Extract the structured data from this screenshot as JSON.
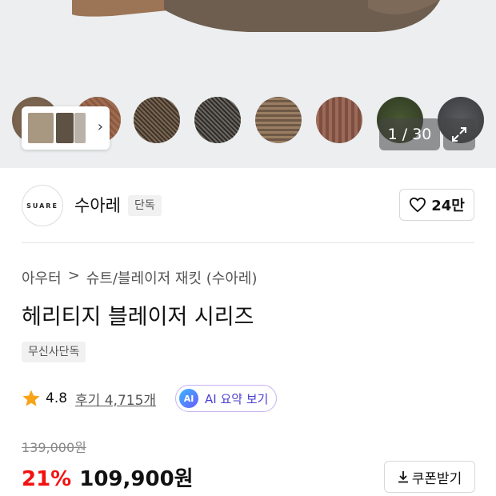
{
  "gallery": {
    "counter": "1 / 30",
    "swatches": [
      {
        "name": "brown-tweed",
        "color": "#7a6450"
      },
      {
        "name": "rust-check",
        "color": "#9b6a4e"
      },
      {
        "name": "houndstooth-brown",
        "color": "#6b5a48"
      },
      {
        "name": "houndstooth-black",
        "color": "#5a5550"
      },
      {
        "name": "glen-check",
        "color": "#8c7258"
      },
      {
        "name": "brown-plaid",
        "color": "#8e5f4f"
      },
      {
        "name": "green-tweed",
        "color": "#3d4a2c"
      },
      {
        "name": "charcoal-tweed",
        "color": "#4a4b4d"
      }
    ],
    "thumbs": [
      "#7a6a55",
      "#5e5244",
      "#c8c2bb"
    ]
  },
  "brand": {
    "logo_text": "SUARE",
    "name": "수아레",
    "badge": "단독",
    "likes": "24만"
  },
  "product": {
    "breadcrumb": [
      "아우터",
      ">",
      "슈트/블레이저 재킷 (수아레)"
    ],
    "title": "헤리티지 블레이저 시리즈",
    "exclusive_tag": "무신사단독",
    "rating": "4.8",
    "reviews": "후기 4,715개",
    "ai_badge": "AI",
    "ai_label": "AI 요약 보기",
    "original_price": "139,000원",
    "discount": "21%",
    "price": "109,900원",
    "coupon_label": "쿠폰받기"
  },
  "colors": {
    "accent_red": "#f31110",
    "star": "#f7a41a",
    "ai_purple": "#4c3fcf"
  }
}
